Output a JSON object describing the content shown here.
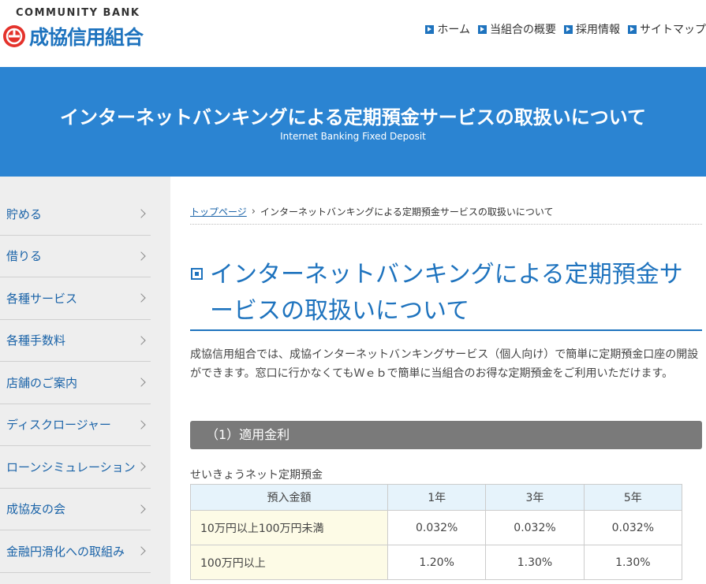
{
  "header": {
    "logo_top": "COMMUNITY BANK",
    "logo_name": "成協信用組合",
    "nav": [
      {
        "label": "ホーム"
      },
      {
        "label": "当組合の概要"
      },
      {
        "label": "採用情報"
      },
      {
        "label": "サイトマップ"
      }
    ]
  },
  "banner": {
    "title": "インターネットバンキングによる定期預金サービスの取扱いについて",
    "subtitle": "Internet Banking Fixed Deposit"
  },
  "sidebar": {
    "items": [
      {
        "label": "貯める"
      },
      {
        "label": "借りる"
      },
      {
        "label": "各種サービス"
      },
      {
        "label": "各種手数料"
      },
      {
        "label": "店舗のご案内"
      },
      {
        "label": "ディスクロージャー"
      },
      {
        "label": "ローンシミュレーション"
      },
      {
        "label": "成協友の会"
      },
      {
        "label": "金融円滑化への取組み"
      }
    ]
  },
  "breadcrumb": {
    "home": "トップページ",
    "current": "インターネットバンキングによる定期預金サービスの取扱いについて"
  },
  "main": {
    "heading": "インターネットバンキングによる定期預金サービスの取扱いについて",
    "intro": "成協信用組合では、成協インターネットバンキングサービス（個人向け）で簡単に定期預金口座の開設ができます。窓口に行かなくてもＷｅｂで簡単に当組合のお得な定期預金をご利用いただけます。",
    "section1_title": "（1）適用金利",
    "table_caption": "せいきょうネット定期預金",
    "table": {
      "headers": [
        "預入金額",
        "1年",
        "3年",
        "5年"
      ],
      "rows": [
        [
          "10万円以上100万円未満",
          "0.032%",
          "0.032%",
          "0.032%"
        ],
        [
          "100万円以上",
          "1.20%",
          "1.30%",
          "1.30%"
        ]
      ]
    }
  },
  "colors": {
    "brand_blue": "#1e73be",
    "banner_blue": "#2b84d2",
    "section_bar": "#7a7a7a",
    "table_header_bg": "#e6f3fb",
    "table_label_bg": "#fdfbe6"
  },
  "icons": [
    "logo-mark-icon",
    "nav-arrow-icon",
    "chevron-right-icon",
    "heading-square-icon"
  ]
}
